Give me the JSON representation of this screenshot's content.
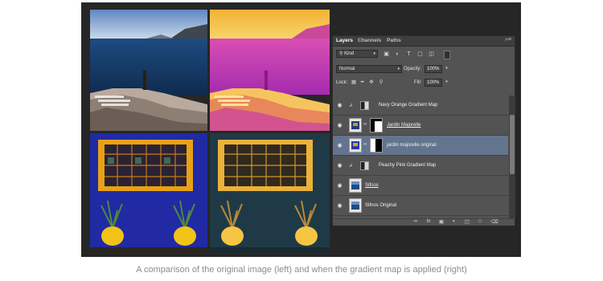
{
  "panel": {
    "tabs": [
      "Layers",
      "Channels",
      "Paths"
    ],
    "menu_icon": "panel-menu-icon",
    "filter_kind": "Kind",
    "blend_mode": "Normal",
    "opacity_label": "Opacity:",
    "opacity_value": "100%",
    "lock_label": "Lock:",
    "fill_label": "Fill:",
    "fill_value": "100%",
    "layers": [
      {
        "name": "Navy Orange Gradient Map",
        "type": "adjustment",
        "clipped": true,
        "selected": false
      },
      {
        "name": "Jardin Majorelle",
        "type": "image",
        "underline": true,
        "selected": false
      },
      {
        "name": "jardin majorelle original",
        "type": "image",
        "selected": true
      },
      {
        "name": "Peachy Pink Gradient Map",
        "type": "adjustment",
        "clipped": true,
        "selected": false
      },
      {
        "name": "Sifnos",
        "type": "image",
        "underline": true,
        "selected": false
      },
      {
        "name": "Sifnos Original",
        "type": "image",
        "selected": false
      }
    ],
    "footer_icons": [
      "link-icon",
      "fx-icon",
      "mask-icon",
      "adjustment-icon",
      "group-folder-icon",
      "new-layer-icon",
      "trash-icon"
    ]
  },
  "caption": "A comparison of the original image (left) and when the gradient map is applied (right)"
}
